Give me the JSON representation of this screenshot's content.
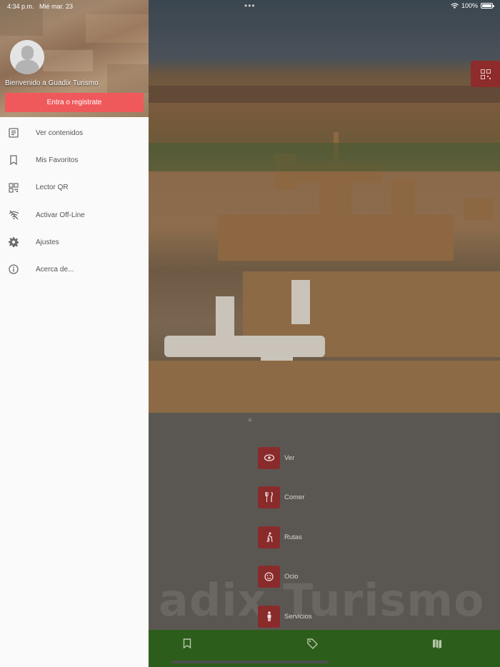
{
  "status_bar": {
    "time": "4:34 p.m.",
    "date": "Mié mar. 23",
    "multitask_dots": "•••",
    "battery": "100%"
  },
  "drawer": {
    "welcome": "Bienvenido a Guadix Turismo",
    "login_button": "Entra o registrate",
    "items": [
      {
        "label": "Ver contenidos",
        "icon": "article-icon"
      },
      {
        "label": "Mis Favoritos",
        "icon": "bookmark-icon"
      },
      {
        "label": "Lector QR",
        "icon": "qr-code-icon"
      },
      {
        "label": "Activar Off-Line",
        "icon": "wifi-off-icon"
      },
      {
        "label": "Ajustes",
        "icon": "gear-icon"
      },
      {
        "label": "Acerca de...",
        "icon": "info-icon"
      }
    ]
  },
  "main": {
    "watermark": "adix Turismo",
    "categories": [
      {
        "label": "Ver",
        "icon": "eye-icon"
      },
      {
        "label": "Comer",
        "icon": "fork-knife-icon"
      },
      {
        "label": "Rutas",
        "icon": "hiker-icon"
      },
      {
        "label": "Ocio",
        "icon": "smiley-icon"
      },
      {
        "label": "Servicios",
        "icon": "person-icon"
      }
    ],
    "bottom_nav": [
      {
        "icon": "bookmark-icon"
      },
      {
        "icon": "tag-icon"
      },
      {
        "icon": "map-icon"
      }
    ]
  },
  "colors": {
    "accent": "#f0595c",
    "category_box": "#8a2b2b",
    "bottom_bar": "#2d5d1a",
    "drawer_bg": "#fafafa"
  }
}
